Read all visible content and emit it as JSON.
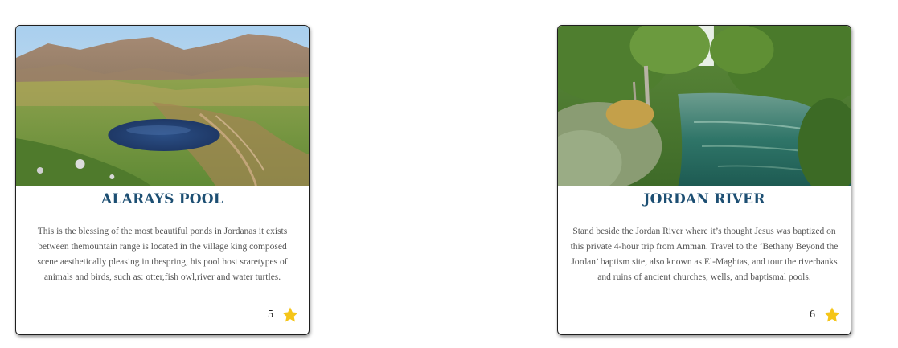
{
  "cards": [
    {
      "title": "ALARAYS POOL",
      "description": "This is the blessing of the most beautiful ponds in Jordanas it exists between themountain range is located in the village king composed scene aesthetically pleasing in thespring, his pool host sraretypes of animals and birds, such as: otter,fish owl,river and water turtles.",
      "rating_count": "5",
      "image": "mountain-pond-landscape"
    },
    {
      "title": "JORDAN RIVER",
      "description": "Stand beside the Jordan River where it’s thought Jesus was baptized on this private 4-hour trip from Amman. Travel to the ‘Bethany Beyond the Jordan’ baptism site, also known as El-Maghtas, and tour the riverbanks and ruins of ancient churches, wells, and baptismal pools.",
      "rating_count": "6",
      "image": "river-with-trees"
    }
  ],
  "colors": {
    "title": "#1d4f73",
    "text": "#555555",
    "star": "#f5c518",
    "border": "#1f1f1f"
  },
  "icons": {
    "rating": "star-icon"
  }
}
